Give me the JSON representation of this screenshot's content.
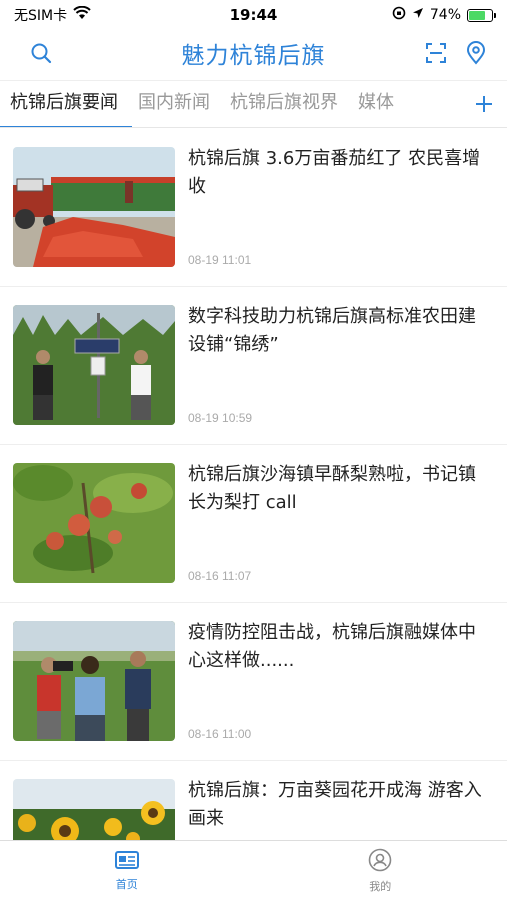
{
  "status_bar": {
    "carrier": "无SIM卡",
    "time": "19:44",
    "battery_percent": "74%",
    "battery_level": 0.74
  },
  "header": {
    "title": "魅力杭锦后旗"
  },
  "tabs": [
    {
      "label": "杭锦后旗要闻",
      "active": true
    },
    {
      "label": "国内新闻",
      "active": false
    },
    {
      "label": "杭锦后旗视界",
      "active": false
    },
    {
      "label": "媒体",
      "active": false
    }
  ],
  "news": [
    {
      "title": "杭锦后旗 3.6万亩番茄红了 农民喜增收",
      "time": "08-19 11:01",
      "image": "tomato-harvest-photo"
    },
    {
      "title": "数字科技助力杭锦后旗高标准农田建设铺“锦绣”",
      "time": "08-19 10:59",
      "image": "solar-farm-sensor-photo"
    },
    {
      "title": "杭锦后旗沙海镇早酥梨熟啦，书记镇长为梨打 call",
      "time": "08-16 11:07",
      "image": "pear-tree-photo"
    },
    {
      "title": "疫情防控阻击战，杭锦后旗融媒体中心这样做......",
      "time": "08-16 11:00",
      "image": "reporters-field-photo"
    },
    {
      "title": "杭锦后旗：万亩葵园花开成海 游客入画来",
      "time": "",
      "image": "sunflower-field-photo"
    }
  ],
  "bottom_nav": [
    {
      "label": "首页",
      "icon": "home-news-icon",
      "active": true
    },
    {
      "label": "我的",
      "icon": "user-profile-icon",
      "active": false
    }
  ],
  "colors": {
    "accent": "#2e83d8",
    "text": "#222222",
    "muted": "#aaaaaa"
  }
}
